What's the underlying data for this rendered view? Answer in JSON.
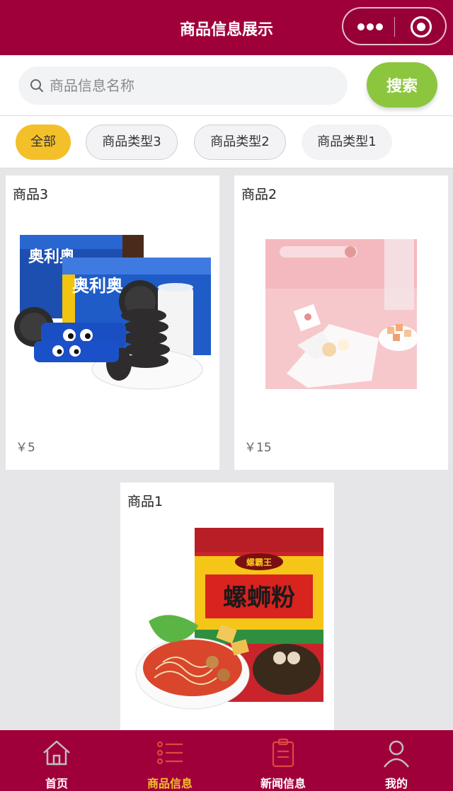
{
  "header": {
    "title": "商品信息展示",
    "capsule": {
      "more": "more-dots-icon",
      "close": "target-icon"
    }
  },
  "search": {
    "placeholder": "商品信息名称",
    "value": "",
    "button_label": "搜索"
  },
  "tabs": [
    {
      "label": "全部",
      "active": true
    },
    {
      "label": "商品类型3",
      "active": false
    },
    {
      "label": "商品类型2",
      "active": false
    },
    {
      "label": "商品类型1",
      "active": false
    }
  ],
  "products": [
    {
      "name": "商品3",
      "price": "￥5",
      "image": "cookie-box-photo"
    },
    {
      "name": "商品2",
      "price": "￥15",
      "image": "pink-dessert-photo"
    },
    {
      "name": "商品1",
      "image": "rice-noodle-package-photo"
    }
  ],
  "packaging_text": {
    "brand": "奥利奥",
    "noodle": "螺蛳粉",
    "noodle_brand": "螺霸王"
  },
  "bottom_nav": [
    {
      "label": "首页",
      "icon": "home-icon",
      "active": false
    },
    {
      "label": "商品信息",
      "icon": "list-icon",
      "active": true
    },
    {
      "label": "新闻信息",
      "icon": "clipboard-icon",
      "active": false
    },
    {
      "label": "我的",
      "icon": "user-icon",
      "active": false
    }
  ],
  "colors": {
    "primary": "#a0003a",
    "accent": "#f4c02a",
    "search_button": "#8cc63f",
    "background": "#e6e6e8"
  }
}
